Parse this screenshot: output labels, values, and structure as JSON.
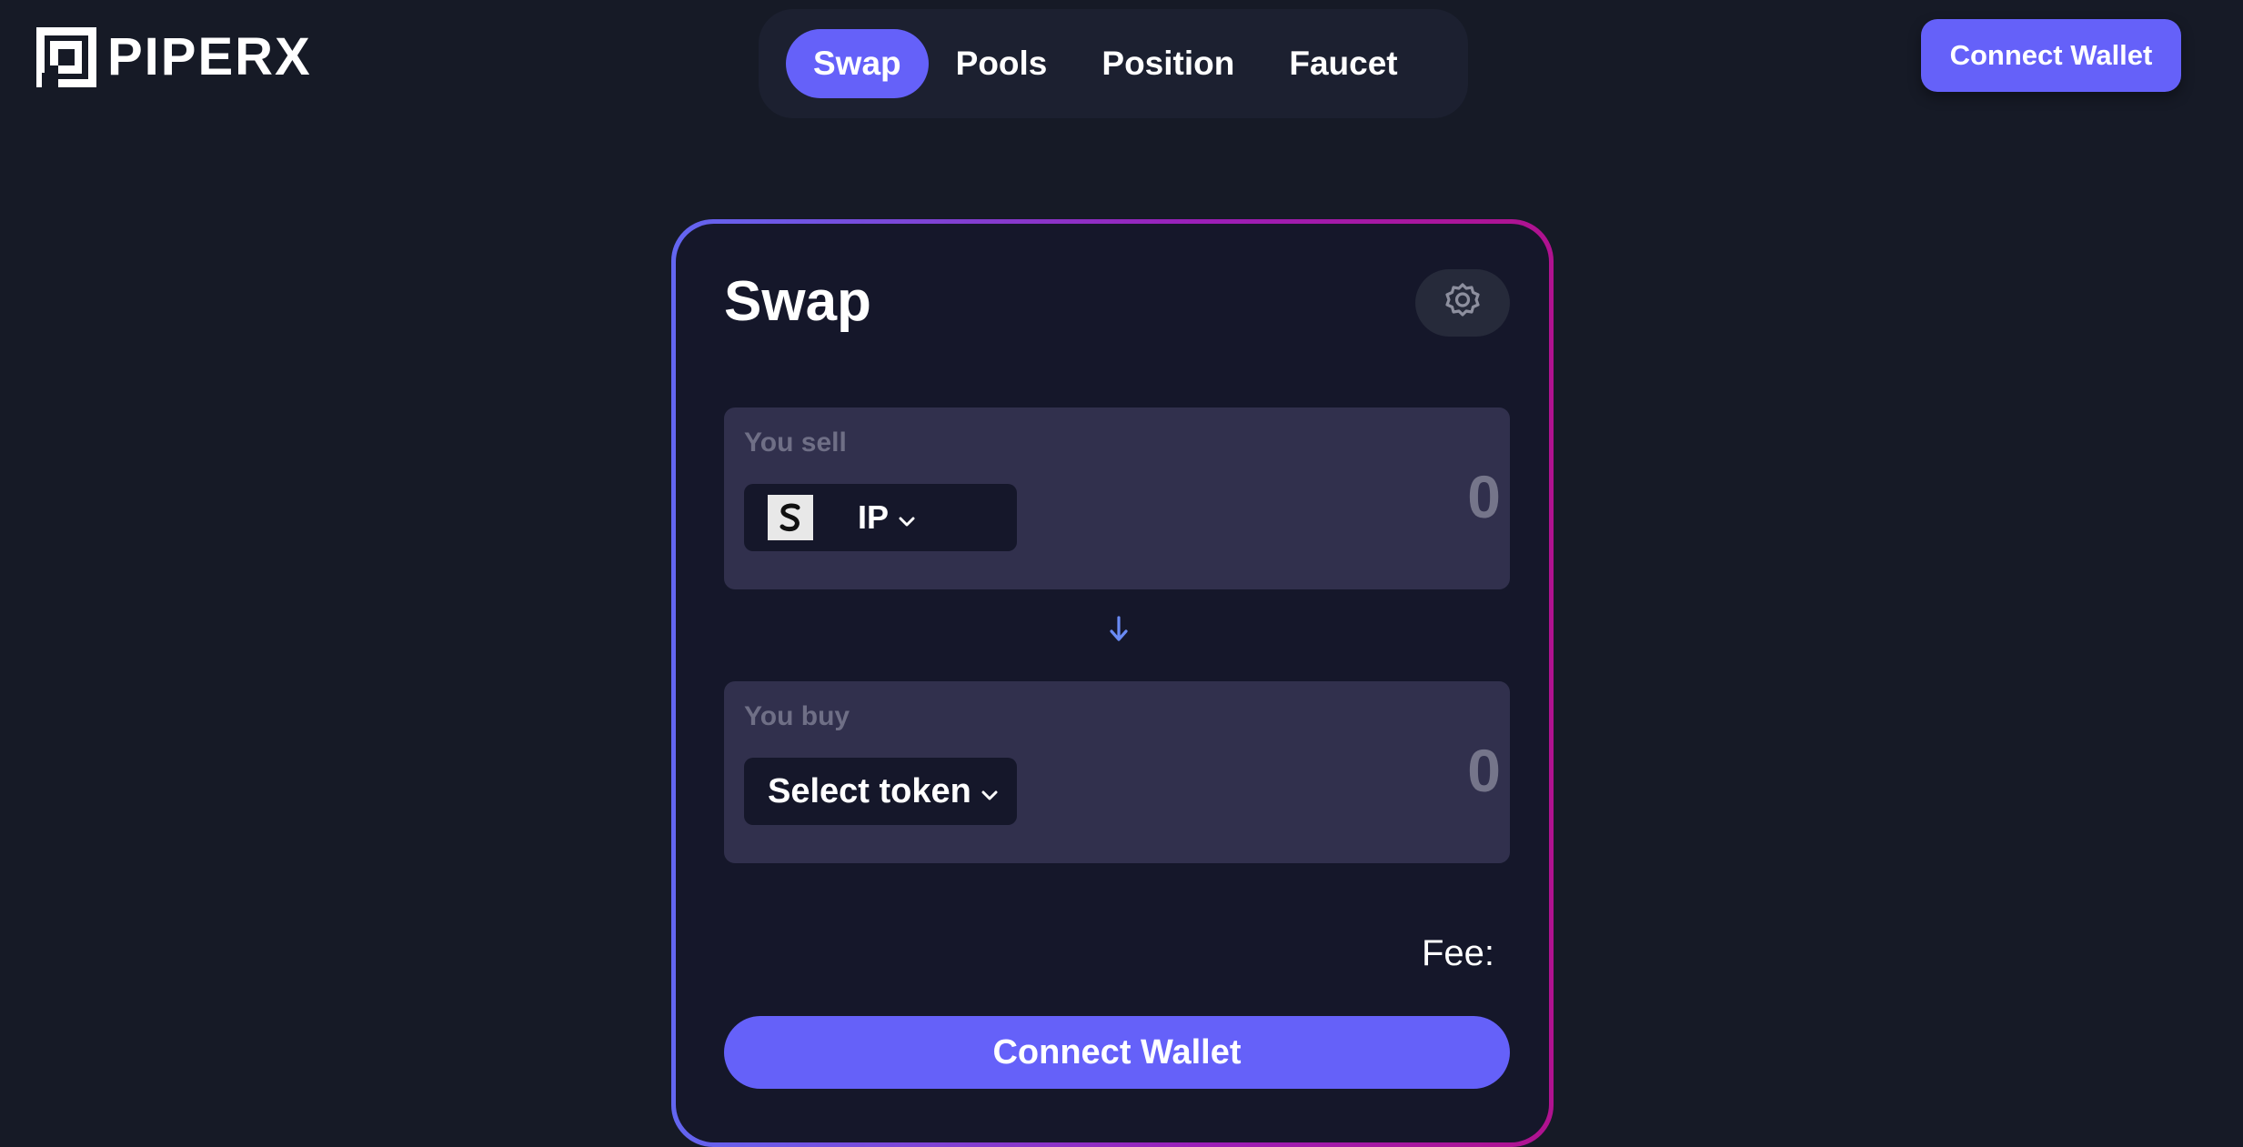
{
  "brand": {
    "name": "PIPERX",
    "logo_icon": "piperx-logo-icon"
  },
  "nav": {
    "items": [
      {
        "label": "Swap",
        "active": true
      },
      {
        "label": "Pools",
        "active": false
      },
      {
        "label": "Position",
        "active": false
      },
      {
        "label": "Faucet",
        "active": false
      }
    ]
  },
  "header": {
    "connect_label": "Connect Wallet"
  },
  "swap_card": {
    "title": "Swap",
    "settings_icon": "gear-icon",
    "sell": {
      "label": "You sell",
      "token_symbol": "IP",
      "token_icon": "story-ip-token-icon",
      "amount": "0"
    },
    "switch_icon": "arrow-down-icon",
    "buy": {
      "label": "You buy",
      "select_label": "Select token",
      "amount": "0"
    },
    "fee_label": "Fee:",
    "connect_label": "Connect Wallet"
  },
  "colors": {
    "background": "#161a26",
    "accent": "#6561f9",
    "card": "#15172a",
    "input_panel": "#31304d",
    "border_gradient_start": "#6366f1",
    "border_gradient_end": "#b0128f"
  }
}
